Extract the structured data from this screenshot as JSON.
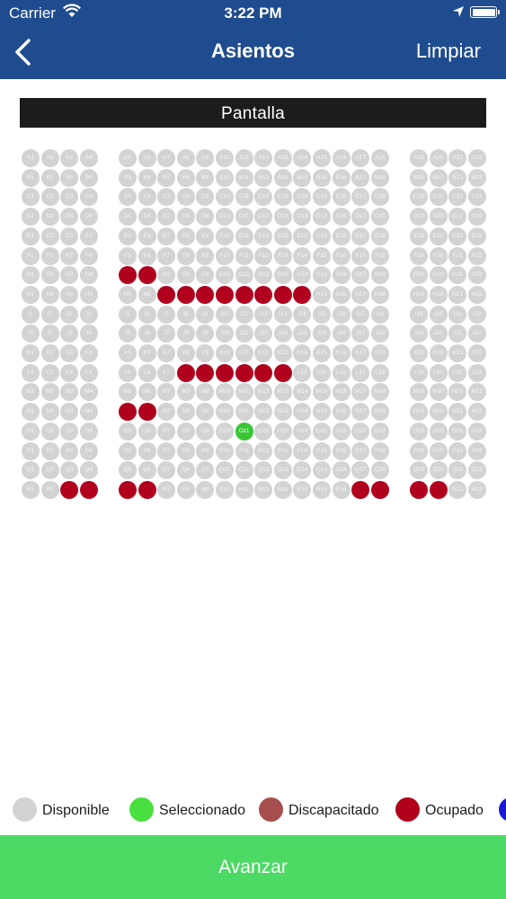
{
  "status_bar": {
    "carrier": "Carrier",
    "time": "3:22 PM"
  },
  "nav": {
    "back_icon": "chevron-left-icon",
    "title": "Asientos",
    "clear_label": "Limpiar"
  },
  "screen_label": "Pantalla",
  "seat_map": {
    "rows": [
      "A",
      "B",
      "C",
      "D",
      "E",
      "F",
      "G",
      "H",
      "I",
      "J",
      "K",
      "L",
      "M",
      "N",
      "O",
      "P",
      "Q",
      "R"
    ],
    "seats_per_row": 22,
    "sections": [
      {
        "name": "left",
        "seats": [
          1,
          4
        ]
      },
      {
        "name": "center",
        "seats": [
          5,
          18
        ]
      },
      {
        "name": "right",
        "seats": [
          19,
          22
        ]
      }
    ],
    "occupied": [
      "G5",
      "G6",
      "H7",
      "H8",
      "H9",
      "H10",
      "H11",
      "H12",
      "H13",
      "H14",
      "L8",
      "L9",
      "L10",
      "L11",
      "L12",
      "L13",
      "N5",
      "N6",
      "R3",
      "R4",
      "R5",
      "R6",
      "R17",
      "R18",
      "R19",
      "R20"
    ],
    "selected": [
      "O11"
    ]
  },
  "legend": [
    {
      "label": "Disponible",
      "color": "#d3d3d4"
    },
    {
      "label": "Seleccionado",
      "color": "#49e03f"
    },
    {
      "label": "Discapacitado",
      "color": "#a64d4d"
    },
    {
      "label": "Ocupado",
      "color": "#b0001e"
    },
    {
      "label": "",
      "color": "#1a1ad6"
    }
  ],
  "advance_button": {
    "label": "Avanzar"
  }
}
